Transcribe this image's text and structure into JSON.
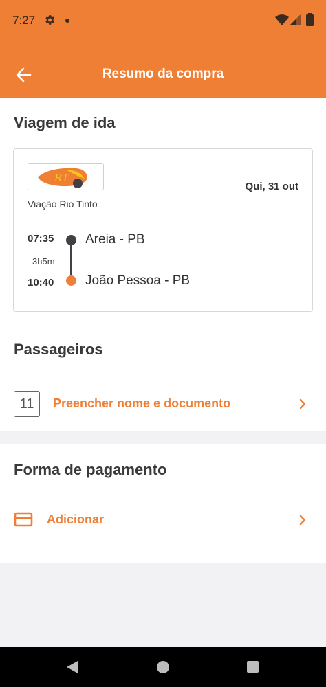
{
  "status_bar": {
    "time": "7:27",
    "icons": [
      "gear-icon",
      "dot-icon",
      "wifi-icon",
      "signal-icon",
      "battery-icon"
    ]
  },
  "app_bar": {
    "title": "Resumo da compra",
    "back_icon": "arrow-left-icon",
    "color": "#f07f36"
  },
  "trip": {
    "section_title": "Viagem de ida",
    "company": "Viação Rio Tinto",
    "logo_text": "RT",
    "date": "Qui, 31 out",
    "departure": {
      "time": "07:35",
      "city": "Areia - PB"
    },
    "duration": "3h5m",
    "arrival": {
      "time": "10:40",
      "city": "João Pessoa - PB"
    }
  },
  "passengers": {
    "section_title": "Passageiros",
    "badge": "11",
    "action_label": "Preencher nome e documento"
  },
  "payment": {
    "section_title": "Forma de pagamento",
    "action_label": "Adicionar",
    "icon": "credit-card-icon"
  },
  "colors": {
    "accent": "#f07f36",
    "timeline_dark": "#414145",
    "background": "#f2f2f4"
  }
}
